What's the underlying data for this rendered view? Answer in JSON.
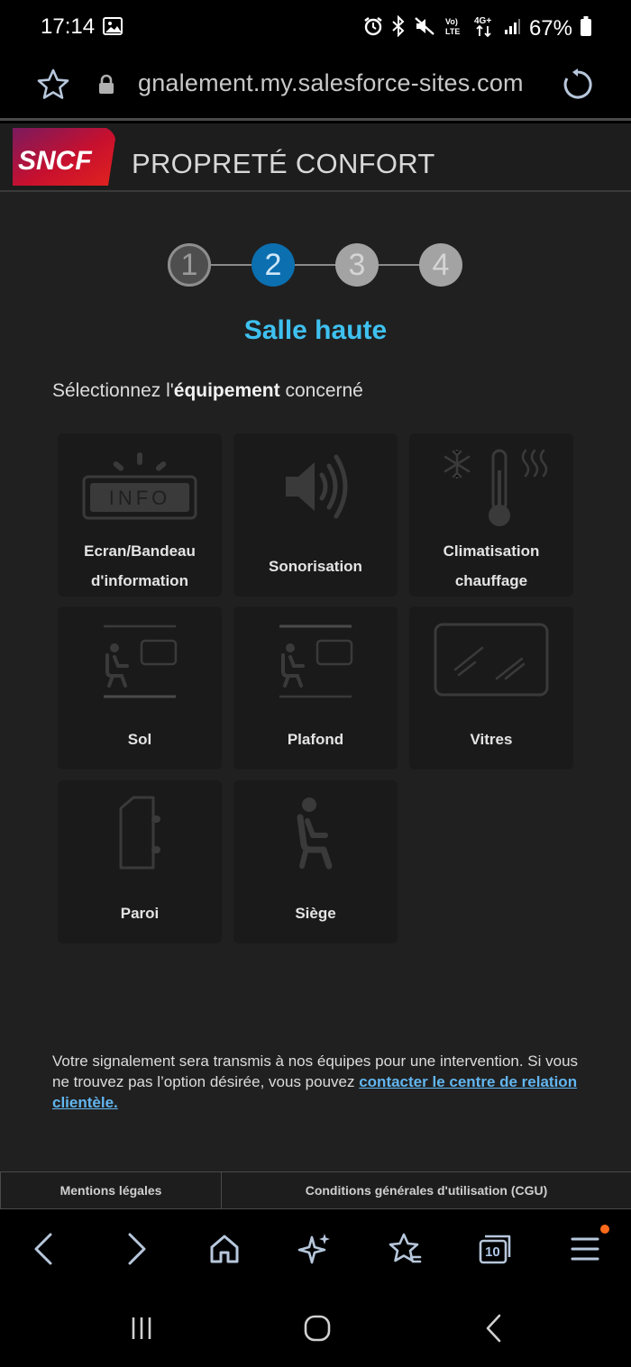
{
  "status_bar": {
    "time": "17:14",
    "battery": "67%",
    "icons": [
      "gallery-icon",
      "alarm-icon",
      "bluetooth-icon",
      "mute-icon",
      "volte-icon",
      "4g-icon",
      "signal-icon",
      "battery-icon"
    ]
  },
  "browser": {
    "url": "gnalement.my.salesforce-sites.com",
    "tab_count": "10"
  },
  "header": {
    "logo_text": "SNCF",
    "title": "PROPRETÉ CONFORT"
  },
  "stepper": {
    "steps": [
      "1",
      "2",
      "3",
      "4"
    ],
    "current": 2
  },
  "section_title": "Salle haute",
  "instruction": {
    "before": "Sélectionnez l'",
    "bold": "équipement",
    "after": " concerné"
  },
  "equipment": [
    {
      "label_line1": "Ecran/Bandeau",
      "label_line2": "d'information",
      "icon": "info-screen-icon",
      "icon_text": "INFO"
    },
    {
      "label_line1": "Sonorisation",
      "icon": "speaker-icon"
    },
    {
      "label_line1": "Climatisation",
      "label_line2": "chauffage",
      "icon": "thermometer-icon"
    },
    {
      "label_line1": "Sol",
      "icon": "floor-icon"
    },
    {
      "label_line1": "Plafond",
      "icon": "ceiling-icon"
    },
    {
      "label_line1": "Vitres",
      "icon": "window-icon"
    },
    {
      "label_line1": "Paroi",
      "icon": "wall-door-icon"
    },
    {
      "label_line1": "Siège",
      "icon": "seat-icon"
    }
  ],
  "footer_note": {
    "text": "Votre signalement sera transmis à nos équipes pour une intervention. Si vous ne trouvez pas l’option désirée, vous pouvez ",
    "link": "contacter le centre de relation clientèle."
  },
  "legal": {
    "mentions": "Mentions légales",
    "cgu": "Conditions générales d'utilisation (CGU)"
  },
  "colors": {
    "accent_blue": "#3ec1f0",
    "step_active": "#0b6fb0",
    "link": "#62b6f0",
    "sncf_red": "#d0112b"
  }
}
